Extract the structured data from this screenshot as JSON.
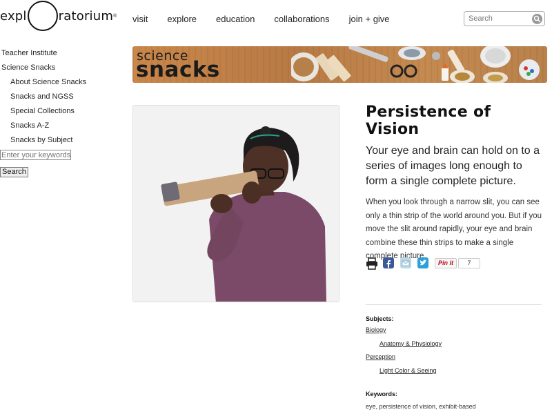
{
  "logo": {
    "left": "expl",
    "right": "ratorium",
    "mark": "®"
  },
  "nav": {
    "items": [
      "visit",
      "explore",
      "education",
      "collaborations",
      "join + give"
    ]
  },
  "search": {
    "placeholder": "Search"
  },
  "sidebar": {
    "items": [
      {
        "label": "Teacher Institute",
        "level": 1
      },
      {
        "label": "Science Snacks",
        "level": 1
      },
      {
        "label": "About Science Snacks",
        "level": 2
      },
      {
        "label": "Snacks and NGSS",
        "level": 2
      },
      {
        "label": "Special Collections",
        "level": 2
      },
      {
        "label": "Snacks A-Z",
        "level": 2
      },
      {
        "label": "Snacks by Subject",
        "level": 2
      }
    ],
    "keyword_placeholder": "Enter your keywords",
    "search_button": "Search"
  },
  "banner": {
    "line1": "science",
    "line2": "snacks"
  },
  "article": {
    "title": "Persistence of Vision",
    "subtitle": "Your eye and brain can hold on to a series of images long enough to form a single complete picture.",
    "description": "When you look through a narrow slit, you can see only a thin strip of the world around you. But if you move the slit around rapidly, your eye and brain combine these thin strips to make a single complete picture."
  },
  "share": {
    "icons": [
      "print-icon",
      "facebook-icon",
      "email-icon",
      "twitter-icon"
    ],
    "pinterest_label": "Pin it",
    "pin_count": "7",
    "colors": {
      "facebook": "#3b5998",
      "twitter": "#2ea0d8",
      "pinterest": "#bd081c"
    }
  },
  "meta": {
    "subjects_label": "Subjects:",
    "subjects": [
      {
        "label": "Biology",
        "level": 1
      },
      {
        "label": "Anatomy & Physiology",
        "level": 2
      },
      {
        "label": "Perception",
        "level": 1
      },
      {
        "label": "Light Color & Seeing",
        "level": 2
      }
    ],
    "keywords_label": "Keywords:",
    "keywords": "eye, persistence of vision, exhibit-based"
  }
}
